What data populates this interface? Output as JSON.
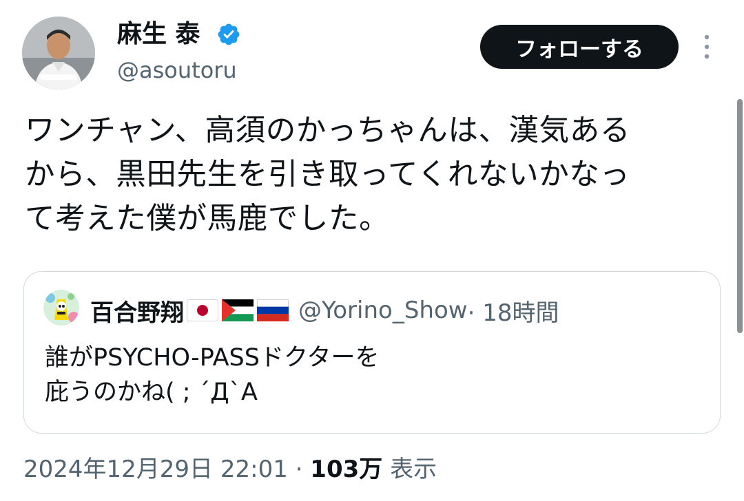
{
  "author": {
    "display_name": "麻生 泰",
    "handle": "@asoutoru",
    "verified_color": "#1d9bf0"
  },
  "follow_button": {
    "label": "フォローする"
  },
  "tweet": {
    "text": "ワンチャン、高須のかっちゃんは、漢気ある\nから、黒田先生を引き取ってくれないかなっ\nて考えた僕が馬鹿でした。"
  },
  "quote": {
    "display_name": "百合野翔",
    "flags": [
      "japan-flag-icon",
      "palestine-flag-icon",
      "russia-flag-icon"
    ],
    "handle": "@Yorino_Show",
    "time": " · 18時間",
    "text": "誰がPSYCHO-PASSドクターを\n庇うのかね( ; ´Д`A"
  },
  "meta": {
    "datetime": "2024年12月29日 22:01 · ",
    "views_count": "103万",
    "views_label": " 表示"
  },
  "icons": {
    "more": "more-vertical-icon",
    "verified": "verified-badge-icon"
  }
}
